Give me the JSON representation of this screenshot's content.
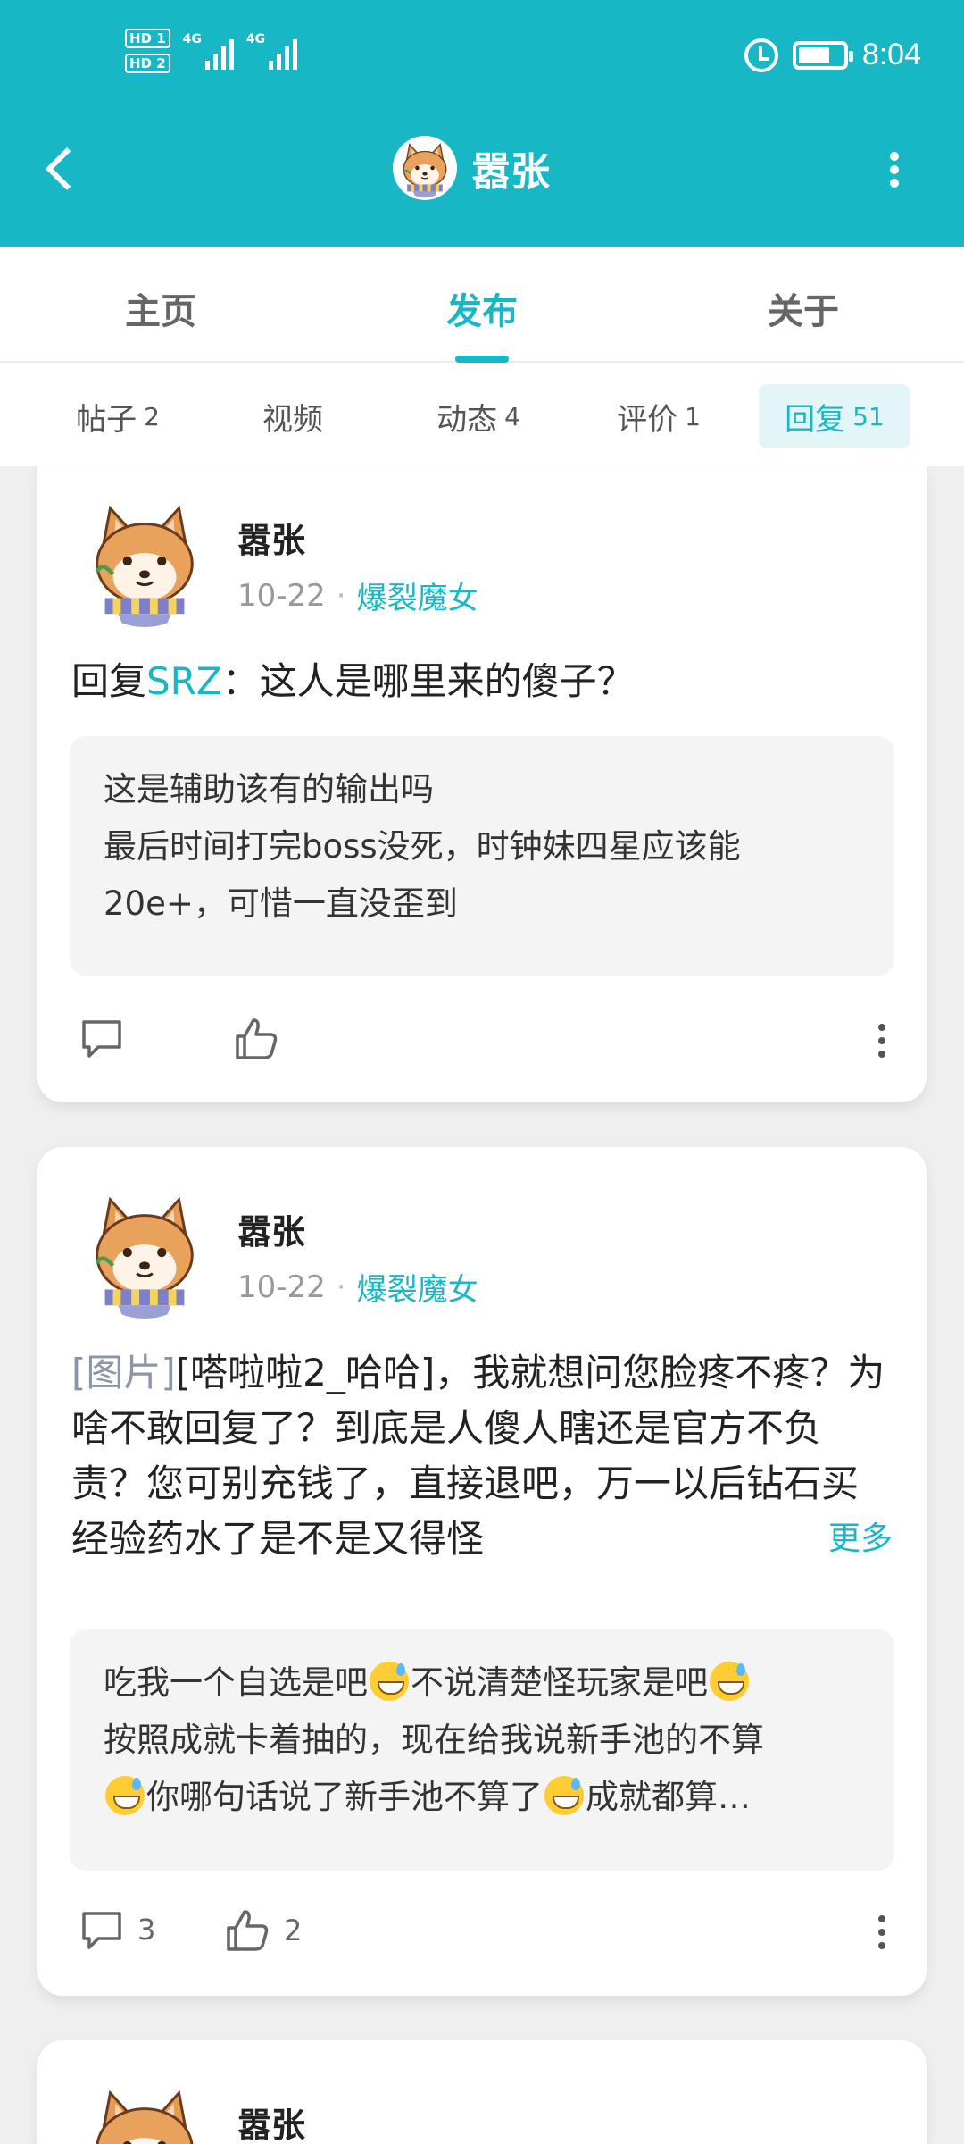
{
  "status": {
    "sim1": "HD 1",
    "sim2": "HD 2",
    "net1": "4G",
    "net2": "4G",
    "time": "8:04"
  },
  "header": {
    "title": "嚣张"
  },
  "main_tabs": [
    {
      "label": "主页",
      "active": false
    },
    {
      "label": "发布",
      "active": true
    },
    {
      "label": "关于",
      "active": false
    }
  ],
  "sub_tabs": [
    {
      "label": "帖子",
      "count": "2"
    },
    {
      "label": "视频",
      "count": ""
    },
    {
      "label": "动态",
      "count": "4"
    },
    {
      "label": "评价",
      "count": "1"
    },
    {
      "label": "回复",
      "count": "51",
      "active": true
    }
  ],
  "colors": {
    "accent": "#17b7c6",
    "background": "#efefef"
  },
  "posts": [
    {
      "author": "嚣张",
      "date": "10-22",
      "dot": "·",
      "game": "爆裂魔女",
      "reply_prefix": "回复",
      "reply_to": "SRZ",
      "reply_text": "：这人是哪里来的傻子？",
      "quote_line1": "这是辅助该有的输出吗",
      "quote_line2": "最后时间打完boss没死，时钟妹四星应该能",
      "quote_line3": "20e+，可惜一直没歪到",
      "comments": "",
      "likes": ""
    },
    {
      "author": "嚣张",
      "date": "10-22",
      "dot": "·",
      "game": "爆裂魔女",
      "img_tag": "[图片]",
      "content": "[嗒啦啦2_哈哈]，我就想问您脸疼不疼？为啥不敢回复了？到底是人傻人瞎还是官方不负责？您可别充钱了，直接退吧，万一以后钻石买经验药水了是不是又得怪",
      "more": "更多",
      "quote_a": "吃我一个自选是吧",
      "quote_b": "不说清楚怪玩家是吧",
      "quote_c": "按照成就卡着抽的，现在给我说新手池的不算",
      "quote_d": "你哪句话说了新手池不算了",
      "quote_e": "成就都算…",
      "comments": "3",
      "likes": "2"
    },
    {
      "author": "嚣张"
    }
  ]
}
